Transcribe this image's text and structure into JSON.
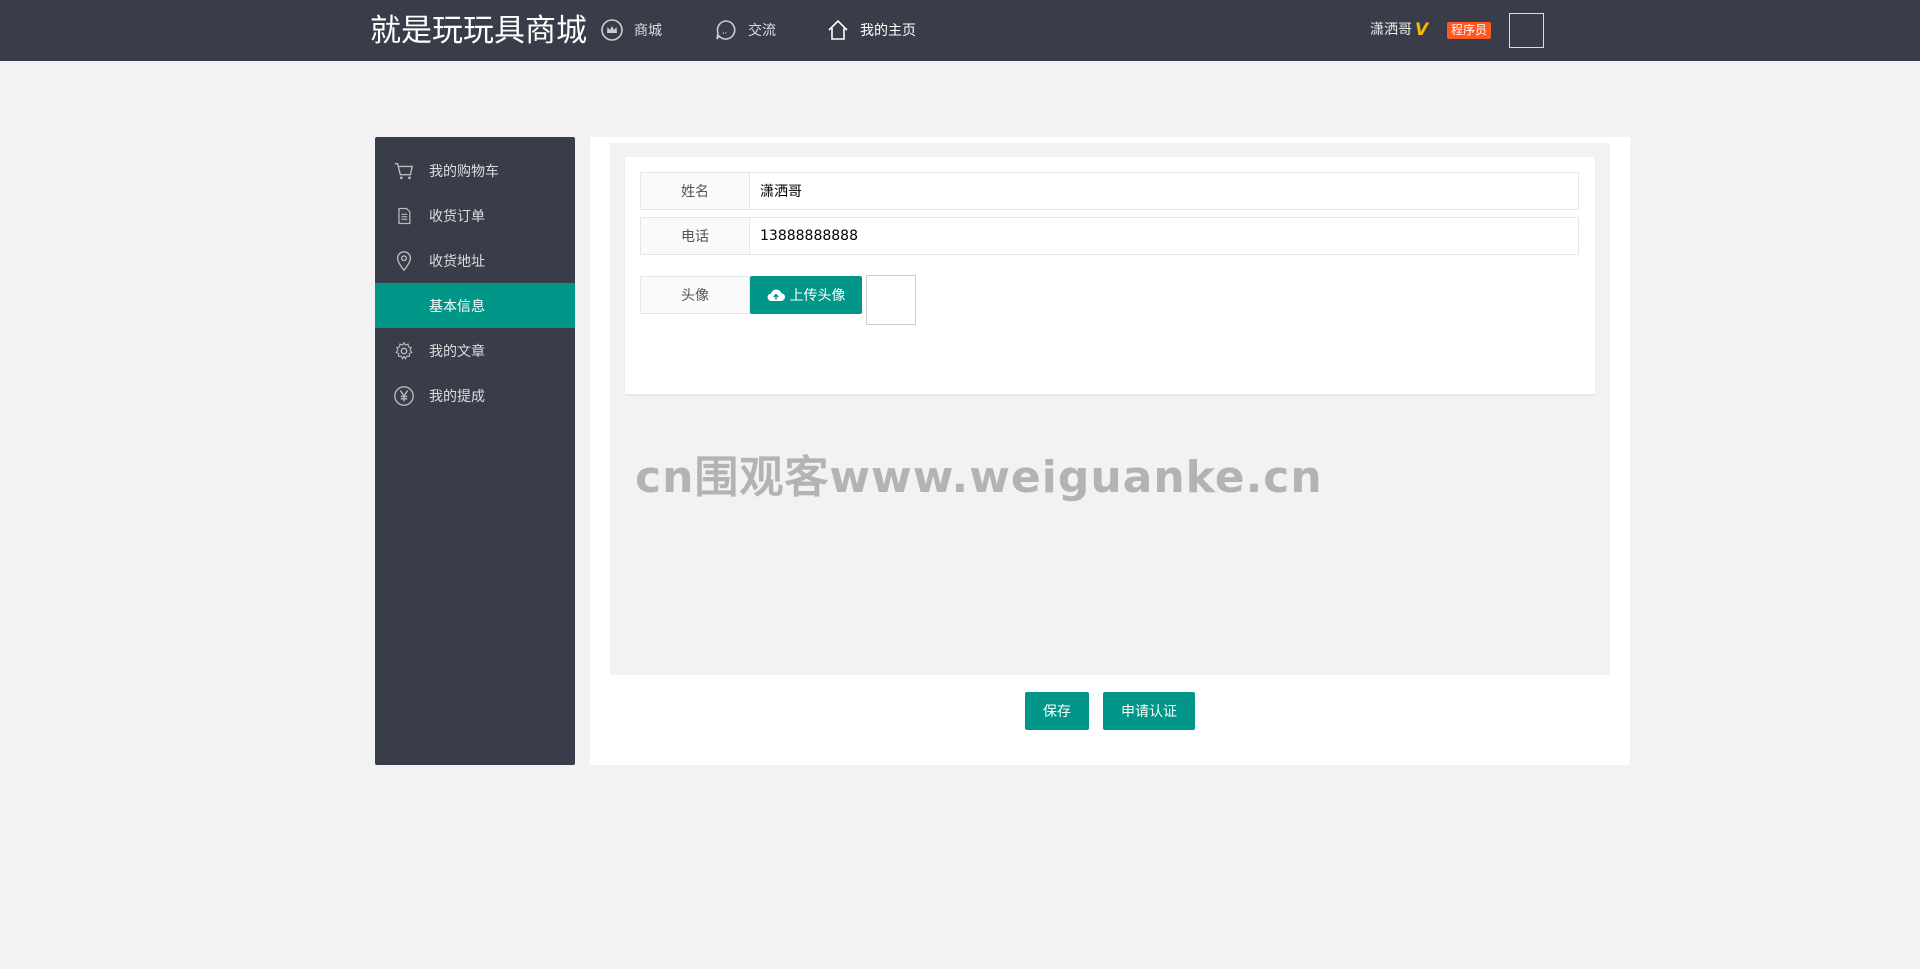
{
  "header": {
    "logo": "就是玩玩具商城",
    "nav": [
      {
        "label": "商城",
        "icon": "crown-icon"
      },
      {
        "label": "交流",
        "icon": "chat-icon"
      },
      {
        "label": "我的主页",
        "icon": "home-icon"
      }
    ],
    "user_name": "潇洒哥",
    "vip_mark": "V",
    "role_badge": "程序员"
  },
  "sidebar": {
    "items": [
      {
        "label": "我的购物车",
        "icon": "cart-icon"
      },
      {
        "label": "收货订单",
        "icon": "document-icon"
      },
      {
        "label": "收货地址",
        "icon": "location-pin-icon"
      },
      {
        "label": "基本信息",
        "icon": "",
        "active": true
      },
      {
        "label": "我的文章",
        "icon": "gear-icon"
      },
      {
        "label": "我的提成",
        "icon": "yen-icon"
      }
    ]
  },
  "form": {
    "name_label": "姓名",
    "name_value": "潇洒哥",
    "phone_label": "电话",
    "phone_value": "13888888888",
    "avatar_label": "头像",
    "upload_label": "上传头像"
  },
  "watermark": "cn围观客www.weiguanke.cn",
  "actions": {
    "save_label": "保存",
    "certify_label": "申请认证"
  },
  "colors": {
    "header_bg": "#393d49",
    "accent": "#009688",
    "badge": "#ff5722",
    "vip": "#ffb800"
  }
}
